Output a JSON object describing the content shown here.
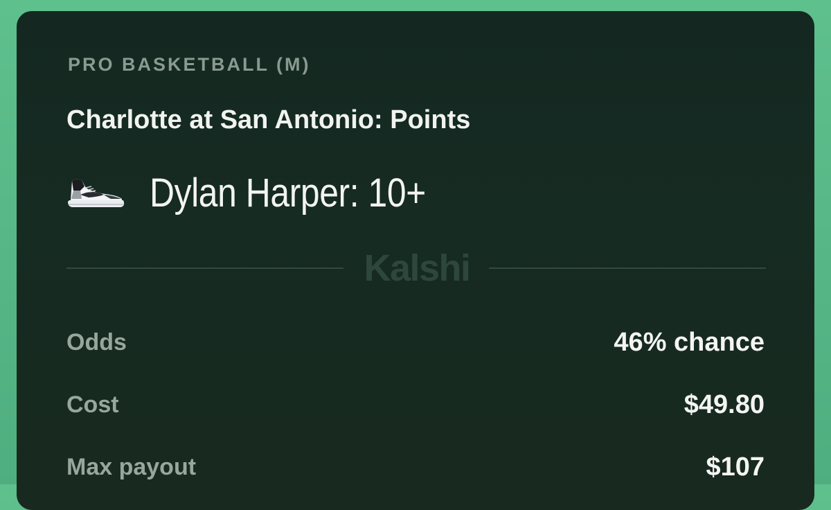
{
  "card": {
    "category": "PRO BASKETBALL (M)",
    "matchup": "Charlotte at San Antonio: Points",
    "pick": {
      "icon": "sneaker-icon",
      "text": "Dylan Harper: 10+"
    },
    "brand": "Kalshi",
    "details": [
      {
        "label": "Odds",
        "value": "46% chance"
      },
      {
        "label": "Cost",
        "value": "$49.80"
      },
      {
        "label": "Max payout",
        "value": "$107"
      }
    ]
  },
  "colors": {
    "background": "#5ec08d",
    "card": "#162b22",
    "label": "#97a79d",
    "value": "#f4f5f3",
    "brand_watermark": "#2e473c"
  }
}
